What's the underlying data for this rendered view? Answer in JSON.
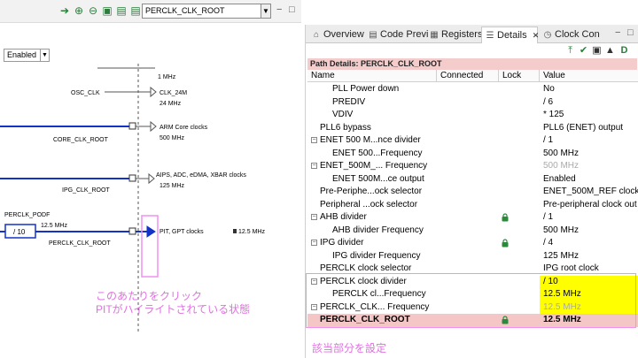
{
  "left_panel": {
    "toolbar": {
      "icons": [
        "arrow-right-icon",
        "zoom-in-icon",
        "zoom-out-icon",
        "fit-view-icon",
        "export-icon",
        "print-icon"
      ],
      "clock_select_value": "PERCLK_CLK_ROOT"
    },
    "enabled_value": "Enabled",
    "diagram": {
      "top_partial_label": "1 MHz",
      "osc_label": "OSC_CLK",
      "clk24_label": "CLK_24M",
      "clk24_freq": "24 MHz",
      "core_label": "CORE_CLK_ROOT",
      "arm_label": "ARM Core clocks",
      "arm_freq": "500 MHz",
      "ipg_label": "IPG_CLK_ROOT",
      "aips_label": "AIPS, ADC, eDMA, XBAR clocks",
      "aips_freq": "125 MHz",
      "podf_label": "PERCLK_PODF",
      "podf_value": "/ 10",
      "perclk_freq": "12.5 MHz",
      "perclk_root_label": "PERCLK_CLK_ROOT",
      "pit_label": "PIT, GPT clocks",
      "pit_freq": "12.5 MHz"
    },
    "annotation_lines": [
      "このあたりをクリック",
      "PITがハイライトされている状態"
    ]
  },
  "right_panel": {
    "tabs": [
      {
        "label": "Overview",
        "icon": "home-icon"
      },
      {
        "label": "Code Previ",
        "icon": "code-icon"
      },
      {
        "label": "Registers",
        "icon": "registers-icon"
      },
      {
        "label": "Details",
        "icon": "details-icon"
      },
      {
        "label": "Clock Con",
        "icon": "clock-icon"
      }
    ],
    "path_header": "Path Details: PERCLK_CLK_ROOT",
    "columns": [
      "Name",
      "Connected",
      "Lock",
      "Value"
    ],
    "rows": [
      {
        "name": "PLL Power down",
        "value": "No"
      },
      {
        "name": "PREDIV",
        "value": "/ 6"
      },
      {
        "name": "VDIV",
        "value": "* 125"
      },
      {
        "name": "PLL6 bypass",
        "value": "PLL6 (ENET) output"
      },
      {
        "name": "ENET 500 M...nce divider",
        "value": "/ 1"
      },
      {
        "name": "ENET 500...Frequency",
        "value": "500 MHz"
      },
      {
        "name": "ENET_500M_... Frequency",
        "value": "500 MHz"
      },
      {
        "name": "ENET 500M...ce output",
        "value": "Enabled"
      },
      {
        "name": "Pre-Periphe...ock selector",
        "value": "ENET_500M_REF clock c"
      },
      {
        "name": "Peripheral ...ock selector",
        "value": "Pre-peripheral clock out"
      },
      {
        "name": "AHB divider",
        "value": "/ 1"
      },
      {
        "name": "AHB divider Frequency",
        "value": "500 MHz"
      },
      {
        "name": "IPG divider",
        "value": "/ 4"
      },
      {
        "name": "IPG divider Frequency",
        "value": "125 MHz"
      },
      {
        "name": "PERCLK clock selector",
        "value": "IPG root clock"
      },
      {
        "name": "PERCLK clock divider",
        "value": "/ 10"
      },
      {
        "name": "PERCLK cl...Frequency",
        "value": "12.5 MHz"
      },
      {
        "name": "PERCLK_CLK... Frequency",
        "value": "12.5 MHz"
      },
      {
        "name": "PERCLK_CLK_ROOT",
        "value": "12.5 MHz"
      }
    ],
    "annotation": "該当部分を設定",
    "colors": {
      "highlight_yellow": "#ffff00",
      "selected_row": "#f4c6c6",
      "annotation_pink": "#e070e0"
    }
  }
}
